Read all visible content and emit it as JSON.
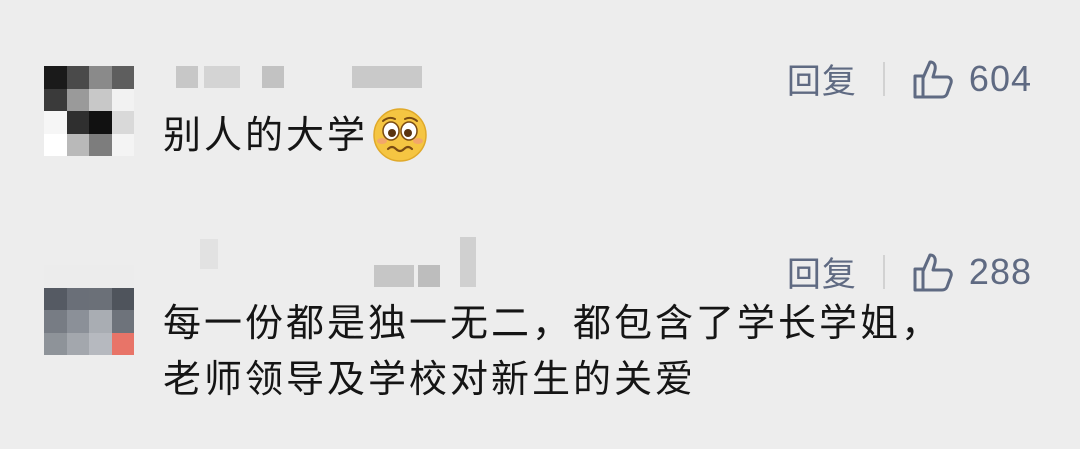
{
  "comments": [
    {
      "reply_label": "回复",
      "like_count": "604",
      "text": "别人的大学",
      "emoji_icon": "woozy-pleading-face-icon",
      "avatar_colors": [
        "#1a1a1a",
        "#4a4a4a",
        "#8a8a8a",
        "#5e5e5e",
        "#3a3a3a",
        "#9a9a9a",
        "#c8c8c8",
        "#f2f2f2",
        "#f6f6f6",
        "#2f2f2f",
        "#111111",
        "#d9d9d9",
        "#ffffff",
        "#b9b9b9",
        "#7d7d7d",
        "#f4f4f4"
      ]
    },
    {
      "reply_label": "回复",
      "like_count": "288",
      "text_line1": "每一份都是独一无二，都包含了学长学姐，",
      "text_line2": "老师领导及学校对新生的关爱",
      "avatar_colors": [
        "#ececec",
        "#ececec",
        "#ececec",
        "#ececec",
        "#555a63",
        "#6a6f78",
        "#6b7078",
        "#4f545c",
        "#777c84",
        "#8b9098",
        "#a9adb3",
        "#6e737b",
        "#8e9399",
        "#a3a7ad",
        "#b6b9bf",
        "#e87468"
      ]
    }
  ],
  "colors": {
    "background": "#ededed",
    "action": "#5f6a82",
    "text": "#151515"
  }
}
